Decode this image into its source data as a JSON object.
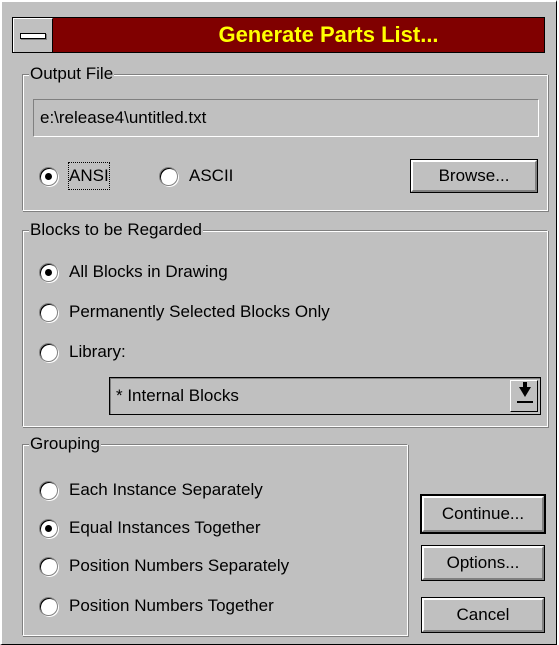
{
  "window": {
    "title": "Generate Parts List..."
  },
  "output_file": {
    "group_label": "Output File",
    "path": "e:\\release4\\untitled.txt",
    "encoding_options": [
      {
        "label": "ANSI",
        "selected": true
      },
      {
        "label": "ASCII",
        "selected": false
      }
    ],
    "browse_label": "Browse..."
  },
  "blocks": {
    "group_label": "Blocks to be Regarded",
    "options": [
      {
        "label": "All Blocks in Drawing",
        "selected": true
      },
      {
        "label": "Permanently Selected Blocks Only",
        "selected": false
      },
      {
        "label": "Library:",
        "selected": false
      }
    ],
    "library_value": "* Internal Blocks"
  },
  "grouping": {
    "group_label": "Grouping",
    "options": [
      {
        "label": "Each Instance Separately",
        "selected": false
      },
      {
        "label": "Equal Instances Together",
        "selected": true
      },
      {
        "label": "Position Numbers Separately",
        "selected": false
      },
      {
        "label": "Position Numbers Together",
        "selected": false
      }
    ]
  },
  "buttons": {
    "continue": "Continue...",
    "options": "Options...",
    "cancel": "Cancel"
  },
  "colors": {
    "title_bg": "#800000",
    "title_text": "#ffff00",
    "face": "#c0c0c0"
  },
  "icons": {
    "system_menu": "system-menu-icon",
    "dropdown": "dropdown-arrow-icon"
  }
}
